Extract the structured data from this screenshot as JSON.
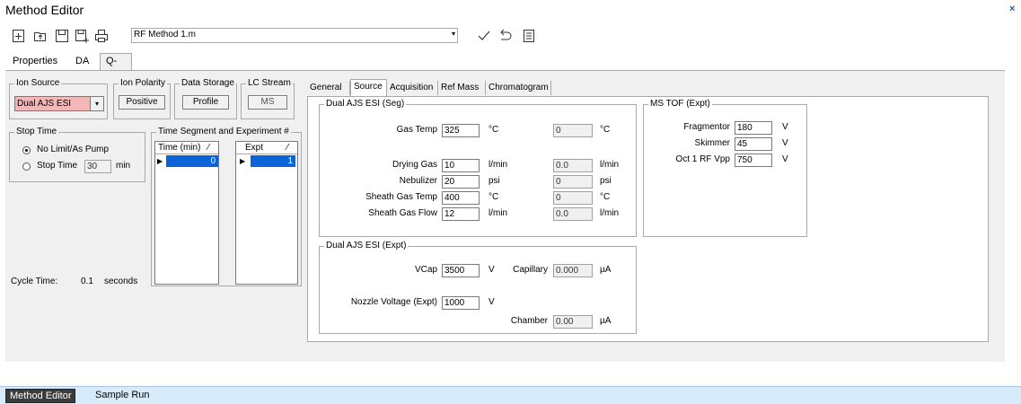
{
  "window": {
    "title": "Method Editor",
    "close_glyph": "×"
  },
  "toolbar": {
    "icons": [
      "new-method-icon",
      "open-method-icon",
      "save-icon",
      "save-as-icon",
      "print-icon"
    ],
    "method_name": "RF Method 1.m",
    "dropdown_glyph": "▾",
    "apply_icon": "checkmark-icon",
    "undo_icon": "undo-icon",
    "report_icon": "checklist-icon"
  },
  "main_tabs": [
    {
      "label": "Properties",
      "active": false
    },
    {
      "label": "DA",
      "active": false
    },
    {
      "label": "Q-TOF",
      "active": true
    }
  ],
  "ion_source": {
    "title": "Ion Source",
    "value": "Dual AJS ESI",
    "highlight": "#f4b7b7"
  },
  "ion_polarity": {
    "title": "Ion Polarity",
    "value": "Positive"
  },
  "data_storage": {
    "title": "Data Storage",
    "value": "Profile"
  },
  "lc_stream": {
    "title": "LC Stream",
    "value": "MS"
  },
  "stop_time": {
    "title": "Stop Time",
    "option_no_limit": "No Limit/As Pump",
    "option_stop_time": "Stop Time",
    "stop_time_value": "30",
    "unit": "min",
    "selected": "no_limit"
  },
  "time_segment": {
    "title": "Time Segment and Experiment #",
    "time_header": "Time (min)",
    "time_value": "0",
    "expt_header": "Expt",
    "expt_value": "1",
    "sort_glyph": "⁄",
    "row_marker": "▶"
  },
  "cycle_time": {
    "label": "Cycle Time:",
    "value": "0.1",
    "unit": "seconds"
  },
  "sub_tabs": [
    {
      "label": "General",
      "active": false
    },
    {
      "label": "Source",
      "active": true
    },
    {
      "label": "Acquisition",
      "active": false
    },
    {
      "label": "Ref Mass",
      "active": false
    },
    {
      "label": "Chromatogram",
      "active": false
    }
  ],
  "seg_group": {
    "title": "Dual AJS ESI (Seg)",
    "rows": [
      {
        "label": "Gas Temp",
        "value": "325",
        "unit": "°C",
        "actual": "0",
        "actual_unit": "°C"
      },
      {
        "label": "Drying Gas",
        "value": "10",
        "unit": "l/min",
        "actual": "0.0",
        "actual_unit": "l/min"
      },
      {
        "label": "Nebulizer",
        "value": "20",
        "unit": "psi",
        "actual": "0",
        "actual_unit": "psi"
      },
      {
        "label": "Sheath Gas Temp",
        "value": "400",
        "unit": "°C",
        "actual": "0",
        "actual_unit": "°C"
      },
      {
        "label": "Sheath Gas Flow",
        "value": "12",
        "unit": "l/min",
        "actual": "0.0",
        "actual_unit": "l/min"
      }
    ]
  },
  "expt_group": {
    "title": "Dual AJS ESI (Expt)",
    "vcap_label": "VCap",
    "vcap_value": "3500",
    "vcap_unit": "V",
    "capillary_label": "Capillary",
    "capillary_value": "0.000",
    "capillary_unit": "µA",
    "nozzle_label": "Nozzle Voltage (Expt)",
    "nozzle_value": "1000",
    "nozzle_unit": "V",
    "chamber_label": "Chamber",
    "chamber_value": "0.00",
    "chamber_unit": "µA"
  },
  "ms_tof_group": {
    "title": "MS TOF (Expt)",
    "rows": [
      {
        "label": "Fragmentor",
        "value": "180",
        "unit": "V"
      },
      {
        "label": "Skimmer",
        "value": "45",
        "unit": "V"
      },
      {
        "label": "Oct 1 RF Vpp",
        "value": "750",
        "unit": "V"
      }
    ]
  },
  "bottom_tabs": [
    {
      "label": "Method Editor",
      "active": true
    },
    {
      "label": "Sample Run",
      "active": false
    }
  ]
}
